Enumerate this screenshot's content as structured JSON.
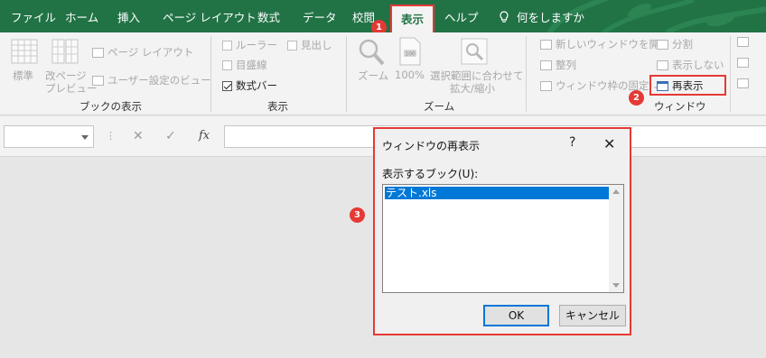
{
  "tabs": [
    {
      "label": "ファイル"
    },
    {
      "label": "ホーム"
    },
    {
      "label": "挿入"
    },
    {
      "label": "ページ レイアウト"
    },
    {
      "label": "数式"
    },
    {
      "label": "データ"
    },
    {
      "label": "校閲"
    },
    {
      "label": "表示",
      "active": true
    },
    {
      "label": "ヘルプ"
    },
    {
      "label": "何をしますか"
    }
  ],
  "ribbon": {
    "book_view": {
      "label": "ブックの表示",
      "normal": "標準",
      "page_break_1": "改ページ",
      "page_break_2": "プレビュー",
      "page_layout": "ページ レイアウト",
      "custom_view": "ユーザー設定のビュー"
    },
    "show": {
      "label": "表示",
      "ruler": "ルーラー",
      "headings": "見出し",
      "gridlines": "目盛線",
      "formula_bar": "数式バー"
    },
    "zoom": {
      "label": "ズーム",
      "zoom": "ズーム",
      "hundred": "100%",
      "selection_1": "選択範囲に合わせて",
      "selection_2": "拡大/縮小"
    },
    "window": {
      "label": "ウィンドウ",
      "new_window": "新しいウィンドウを開く",
      "arrange": "整列",
      "freeze": "ウィンドウ枠の固定",
      "split": "分割",
      "hide": "表示しない",
      "unhide": "再表示"
    }
  },
  "formula_bar": {
    "cancel": "✕",
    "enter": "✓",
    "fx": "fx"
  },
  "dialog": {
    "title": "ウィンドウの再表示",
    "help": "?",
    "close": "✕",
    "list_label": "表示するブック(U):",
    "items": [
      "テスト.xls"
    ],
    "ok": "OK",
    "cancel": "キャンセル"
  },
  "badges": [
    "1",
    "2",
    "3"
  ],
  "colors": {
    "excel_green": "#217346",
    "highlight_red": "#e53935",
    "selection_blue": "#0078d7"
  }
}
